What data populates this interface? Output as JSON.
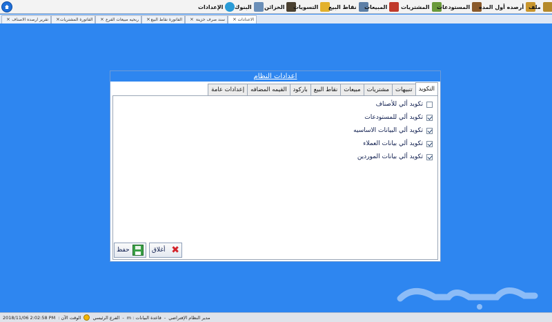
{
  "menubar": {
    "items": [
      {
        "label": "ملف",
        "icon": "file-icon",
        "color": "#c9962d"
      },
      {
        "label": "أرصده أول المده",
        "icon": "opening-balance-icon",
        "color": "#8a5a2b"
      },
      {
        "label": "المستودعات",
        "icon": "warehouse-icon",
        "color": "#6a9a3a"
      },
      {
        "label": "المشتريات",
        "icon": "purchases-icon",
        "color": "#c0392b"
      },
      {
        "label": "المبيعات",
        "icon": "sales-icon",
        "color": "#5d7fa6"
      },
      {
        "label": "نقاط البيع",
        "icon": "pos-icon",
        "color": "#e3b12b"
      },
      {
        "label": "التسويات",
        "icon": "adjustments-icon",
        "color": "#333333"
      },
      {
        "label": "الخزائن",
        "icon": "safes-icon",
        "color": "#7d6a4b"
      },
      {
        "label": "البنوك",
        "icon": "banks-icon",
        "color": "#6b8fb8"
      },
      {
        "label": "الإعدادات",
        "icon": "settings-icon",
        "color": "#2a9bd6"
      }
    ]
  },
  "tabs": [
    {
      "label": "الاعدادات",
      "active": true
    },
    {
      "label": "سند صرف خزينة",
      "active": false
    },
    {
      "label": "الفاتورة نقاط البيع",
      "active": false
    },
    {
      "label": "ربحيه مبيعات الفرع",
      "active": false
    },
    {
      "label": "الفاتورة المشتريات",
      "active": false
    },
    {
      "label": "تقرير ارصده الاصناف",
      "active": false
    }
  ],
  "dialog": {
    "title": "اعدادات النظام",
    "tabs": [
      {
        "label": "التكويد",
        "active": true
      },
      {
        "label": "تنبيهات",
        "active": false
      },
      {
        "label": "مشتريات",
        "active": false
      },
      {
        "label": "مبيعات",
        "active": false
      },
      {
        "label": "نقاط البيع",
        "active": false
      },
      {
        "label": "باركود",
        "active": false
      },
      {
        "label": "القيمه المضافه",
        "active": false
      },
      {
        "label": "إعدادات عامة",
        "active": false
      }
    ],
    "options": [
      {
        "label": "تكويد ألي للأصناف",
        "checked": false
      },
      {
        "label": "تكويد ألي للمستودعات",
        "checked": true
      },
      {
        "label": "تكويد ألي البيانات الاساسيه",
        "checked": true
      },
      {
        "label": "تكويد ألي بيانات العملاء",
        "checked": true
      },
      {
        "label": "تكويد ألي بيانات الموردين",
        "checked": true
      }
    ],
    "close_label": "أغلاق",
    "save_label": "حفظ"
  },
  "watermark": {
    "text": "حراج"
  },
  "statusbar": {
    "user": "مدير النظام الإفتراضي",
    "database": "قاعدة البيانات : m",
    "branch": "الفرع الرئيسي",
    "time_label": "الوقت الآن :",
    "time_value": "2018/11/06  2:02:58 PM"
  }
}
